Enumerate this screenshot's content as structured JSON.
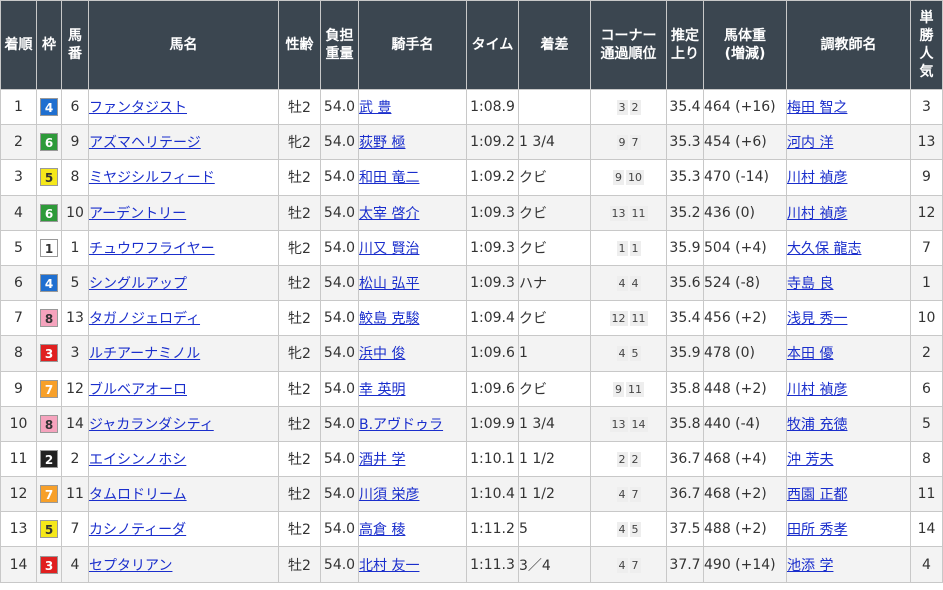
{
  "headers": {
    "chakujun": "着順",
    "waku": "枠",
    "umaban": "馬番",
    "horse": "馬名",
    "sexage": "性齢",
    "weight": "負担重量",
    "jockey": "騎手名",
    "time": "タイム",
    "margin": "着差",
    "corner_line1": "コーナー",
    "corner_line2": "通過順位",
    "last3f": "推定上り",
    "body_line1": "馬体重",
    "body_line2": "(増減)",
    "trainer": "調教師名",
    "popularity": "単勝人気"
  },
  "waku_colors": {
    "1": {
      "bg": "#ffffff",
      "fg": "#333333"
    },
    "2": {
      "bg": "#222222",
      "fg": "#ffffff"
    },
    "3": {
      "bg": "#e02020",
      "fg": "#ffffff"
    },
    "4": {
      "bg": "#1f6fd0",
      "fg": "#ffffff"
    },
    "5": {
      "bg": "#f5e81a",
      "fg": "#333333"
    },
    "6": {
      "bg": "#2e9a3a",
      "fg": "#ffffff"
    },
    "7": {
      "bg": "#f7a02a",
      "fg": "#ffffff"
    },
    "8": {
      "bg": "#f5a3bd",
      "fg": "#333333"
    }
  },
  "rows": [
    {
      "rank": "1",
      "waku": "4",
      "umaban": "6",
      "horse": "ファンタジスト",
      "sexage": "牡2",
      "weight": "54.0",
      "jockey": "武 豊",
      "time": "1:08.9",
      "margin": "",
      "corners": [
        "3",
        "2"
      ],
      "last3f": "35.4",
      "body": "464 (+16)",
      "trainer": "梅田 智之",
      "pop": "3"
    },
    {
      "rank": "2",
      "waku": "6",
      "umaban": "9",
      "horse": "アズマヘリテージ",
      "sexage": "牝2",
      "weight": "54.0",
      "jockey": "荻野 極",
      "time": "1:09.2",
      "margin": "1 3/4",
      "corners": [
        "9",
        "7"
      ],
      "last3f": "35.3",
      "body": "454 (+6)",
      "trainer": "河内 洋",
      "pop": "13"
    },
    {
      "rank": "3",
      "waku": "5",
      "umaban": "8",
      "horse": "ミヤジシルフィード",
      "sexage": "牡2",
      "weight": "54.0",
      "jockey": "和田 竜二",
      "time": "1:09.2",
      "margin": "クビ",
      "corners": [
        "9",
        "10"
      ],
      "last3f": "35.3",
      "body": "470 (-14)",
      "trainer": "川村 禎彦",
      "pop": "9"
    },
    {
      "rank": "4",
      "waku": "6",
      "umaban": "10",
      "horse": "アーデントリー",
      "sexage": "牡2",
      "weight": "54.0",
      "jockey": "太宰 啓介",
      "time": "1:09.3",
      "margin": "クビ",
      "corners": [
        "13",
        "11"
      ],
      "last3f": "35.2",
      "body": "436 (0)",
      "trainer": "川村 禎彦",
      "pop": "12"
    },
    {
      "rank": "5",
      "waku": "1",
      "umaban": "1",
      "horse": "チュウワフライヤー",
      "sexage": "牝2",
      "weight": "54.0",
      "jockey": "川又 賢治",
      "time": "1:09.3",
      "margin": "クビ",
      "corners": [
        "1",
        "1"
      ],
      "last3f": "35.9",
      "body": "504 (+4)",
      "trainer": "大久保 龍志",
      "pop": "7"
    },
    {
      "rank": "6",
      "waku": "4",
      "umaban": "5",
      "horse": "シングルアップ",
      "sexage": "牡2",
      "weight": "54.0",
      "jockey": "松山 弘平",
      "time": "1:09.3",
      "margin": "ハナ",
      "corners": [
        "4",
        "4"
      ],
      "last3f": "35.6",
      "body": "524 (-8)",
      "trainer": "寺島 良",
      "pop": "1"
    },
    {
      "rank": "7",
      "waku": "8",
      "umaban": "13",
      "horse": "タガノジェロディ",
      "sexage": "牡2",
      "weight": "54.0",
      "jockey": "鮫島 克駿",
      "time": "1:09.4",
      "margin": "クビ",
      "corners": [
        "12",
        "11"
      ],
      "last3f": "35.4",
      "body": "456 (+2)",
      "trainer": "浅見 秀一",
      "pop": "10"
    },
    {
      "rank": "8",
      "waku": "3",
      "umaban": "3",
      "horse": "ルチアーナミノル",
      "sexage": "牝2",
      "weight": "54.0",
      "jockey": "浜中 俊",
      "time": "1:09.6",
      "margin": "1",
      "corners": [
        "4",
        "5"
      ],
      "last3f": "35.9",
      "body": "478 (0)",
      "trainer": "本田 優",
      "pop": "2"
    },
    {
      "rank": "9",
      "waku": "7",
      "umaban": "12",
      "horse": "ブルベアオーロ",
      "sexage": "牡2",
      "weight": "54.0",
      "jockey": "幸 英明",
      "time": "1:09.6",
      "margin": "クビ",
      "corners": [
        "9",
        "11"
      ],
      "last3f": "35.8",
      "body": "448 (+2)",
      "trainer": "川村 禎彦",
      "pop": "6"
    },
    {
      "rank": "10",
      "waku": "8",
      "umaban": "14",
      "horse": "ジャカランダシティ",
      "sexage": "牡2",
      "weight": "54.0",
      "jockey": "B.アヴドゥラ",
      "time": "1:09.9",
      "margin": "1 3/4",
      "corners": [
        "13",
        "14"
      ],
      "last3f": "35.8",
      "body": "440 (-4)",
      "trainer": "牧浦 充徳",
      "pop": "5"
    },
    {
      "rank": "11",
      "waku": "2",
      "umaban": "2",
      "horse": "エイシンノホシ",
      "sexage": "牡2",
      "weight": "54.0",
      "jockey": "酒井 学",
      "time": "1:10.1",
      "margin": "1 1/2",
      "corners": [
        "2",
        "2"
      ],
      "last3f": "36.7",
      "body": "468 (+4)",
      "trainer": "沖 芳夫",
      "pop": "8"
    },
    {
      "rank": "12",
      "waku": "7",
      "umaban": "11",
      "horse": "タムロドリーム",
      "sexage": "牡2",
      "weight": "54.0",
      "jockey": "川須 栄彦",
      "time": "1:10.4",
      "margin": "1 1/2",
      "corners": [
        "4",
        "7"
      ],
      "last3f": "36.7",
      "body": "468 (+2)",
      "trainer": "西園 正都",
      "pop": "11"
    },
    {
      "rank": "13",
      "waku": "5",
      "umaban": "7",
      "horse": "カシノティーダ",
      "sexage": "牡2",
      "weight": "54.0",
      "jockey": "高倉 稜",
      "time": "1:11.2",
      "margin": "5",
      "corners": [
        "4",
        "5"
      ],
      "last3f": "37.5",
      "body": "488 (+2)",
      "trainer": "田所 秀孝",
      "pop": "14"
    },
    {
      "rank": "14",
      "waku": "3",
      "umaban": "4",
      "horse": "セプタリアン",
      "sexage": "牡2",
      "weight": "54.0",
      "jockey": "北村 友一",
      "time": "1:11.3",
      "margin": "3／4",
      "corners": [
        "4",
        "7"
      ],
      "last3f": "37.7",
      "body": "490 (+14)",
      "trainer": "池添 学",
      "pop": "4"
    }
  ]
}
